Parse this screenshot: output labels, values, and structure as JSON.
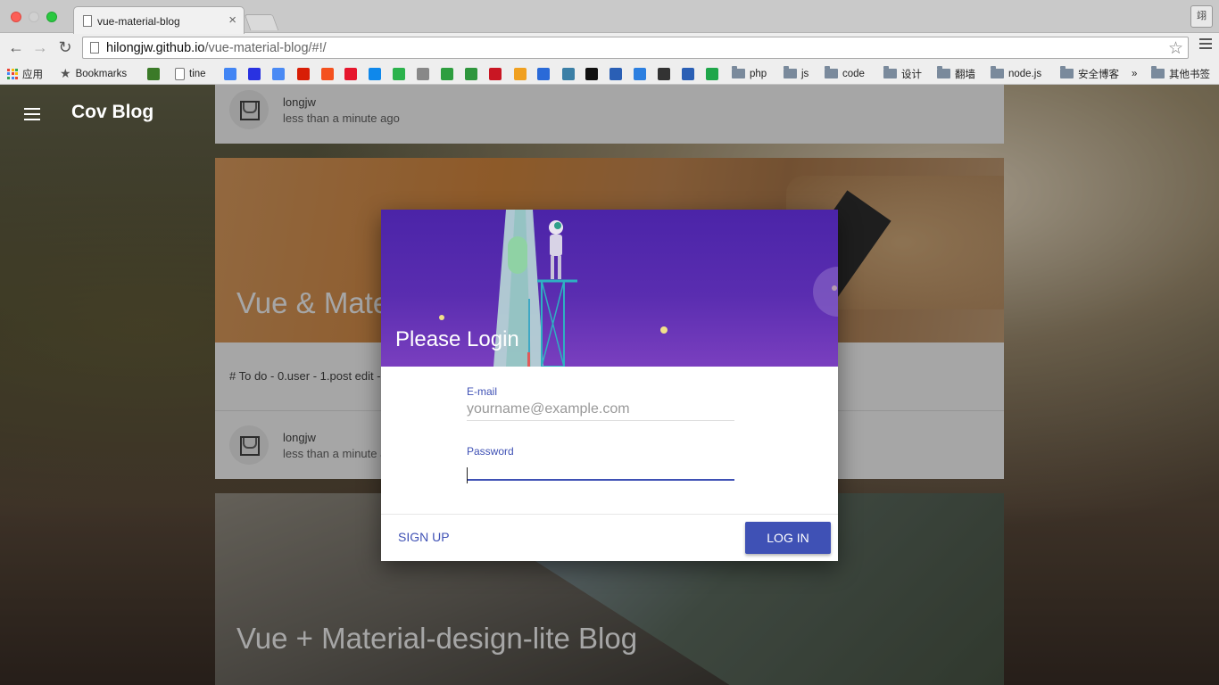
{
  "browser": {
    "tab_title": "vue-material-blog",
    "tab_close": "×",
    "profile_label": "翊",
    "url_host": "hilongjw.github.io",
    "url_path": "/vue-material-blog/#!/",
    "bookmarks": [
      {
        "label": "应用",
        "icon": "apps-icon"
      },
      {
        "label": "Bookmarks",
        "icon": "star-icon"
      },
      {
        "label": "",
        "icon": "game-icon"
      },
      {
        "label": "tine",
        "icon": "page-icon"
      },
      {
        "label": "",
        "icon": "google-icon"
      },
      {
        "label": "",
        "icon": "baidu-icon"
      },
      {
        "label": "",
        "icon": "translate-icon"
      },
      {
        "label": "",
        "icon": "netease-music-icon"
      },
      {
        "label": "",
        "icon": "fire-icon"
      },
      {
        "label": "",
        "icon": "weibo-icon"
      },
      {
        "label": "",
        "icon": "zhihu-icon"
      },
      {
        "label": "",
        "icon": "cloud-icon"
      },
      {
        "label": "",
        "icon": "chat-icon"
      },
      {
        "label": "",
        "icon": "f-icon"
      },
      {
        "label": "",
        "icon": "douban-icon"
      },
      {
        "label": "",
        "icon": "jd-icon"
      },
      {
        "label": "",
        "icon": "paw-icon"
      },
      {
        "label": "",
        "icon": "n-icon"
      },
      {
        "label": "",
        "icon": "wave-icon"
      },
      {
        "label": "",
        "icon": "pulse-icon"
      },
      {
        "label": "",
        "icon": "w-icon"
      },
      {
        "label": "",
        "icon": "kr-icon"
      },
      {
        "label": "",
        "icon": "stripe-icon"
      },
      {
        "label": "",
        "icon": "up-arrow-icon"
      },
      {
        "label": "",
        "icon": "green-chat-icon"
      },
      {
        "label": "php",
        "icon": "folder-icon"
      },
      {
        "label": "js",
        "icon": "folder-icon"
      },
      {
        "label": "code",
        "icon": "folder-icon"
      },
      {
        "label": "设计",
        "icon": "folder-icon"
      },
      {
        "label": "翻墙",
        "icon": "folder-icon"
      },
      {
        "label": "node.js",
        "icon": "folder-icon"
      },
      {
        "label": "安全博客",
        "icon": "folder-icon"
      }
    ],
    "bookmarks_overflow": "»",
    "other_bookmarks": "其他书签"
  },
  "site": {
    "title": "Cov Blog"
  },
  "posts": [
    {
      "author": "longjw",
      "time": "less than a minute ago"
    },
    {
      "title": "Vue & Material-design-lite Blog",
      "excerpt": "# To do - 0.user - 1.post edit - 2.comment",
      "author": "longjw",
      "time": "less than a minute ago"
    },
    {
      "title": "Vue + Material-design-lite Blog"
    }
  ],
  "login_dialog": {
    "title": "Please Login",
    "email_label": "E-mail",
    "email_placeholder": "yourname@example.com",
    "password_label": "Password",
    "signup_label": "SIGN UP",
    "login_label": "LOG IN"
  },
  "colors": {
    "primary": "#3f51b5",
    "dialog_header": "#5a2db0"
  }
}
